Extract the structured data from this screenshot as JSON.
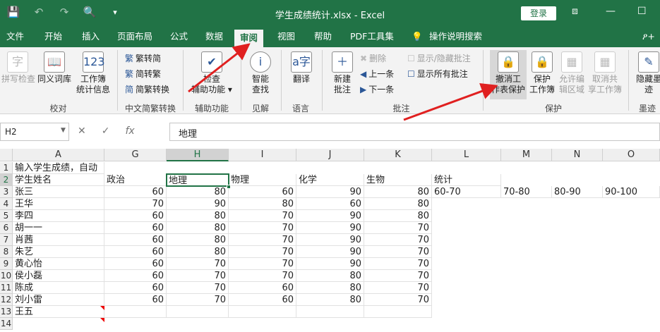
{
  "titlebar": {
    "title": "学生成绩统计.xlsx - Excel",
    "login": "登录",
    "qat": {
      "save_icon": "💾",
      "undo_icon": "↶",
      "redo_icon": "↷",
      "preview_icon": "🔍",
      "more_icon": "▾"
    },
    "win": {
      "restore": "⧈",
      "min": "—",
      "max": "☐"
    }
  },
  "menu": {
    "tabs": [
      "文件",
      "开始",
      "插入",
      "页面布局",
      "公式",
      "数据",
      "审阅",
      "视图",
      "帮助",
      "PDF工具集",
      "操作说明搜索"
    ],
    "share": "ዖ+"
  },
  "ribbon": {
    "spell": "拼写检查",
    "thesaurus": "同义词库",
    "stats_line1": "工作簿",
    "stats_line2": "统计信息",
    "to_trad": "繁转简",
    "to_simp": "简转繁",
    "conv": "简繁转换",
    "check_line1": "检查",
    "check_line2": "辅助功能",
    "smart_line1": "智能",
    "smart_line2": "查找",
    "translate": "翻译",
    "newc_line1": "新建",
    "newc_line2": "批注",
    "del": "删除",
    "prev": "上一条",
    "next": "下一条",
    "showhide": "显示/隐藏批注",
    "showall": "显示所有批注",
    "unprotect_line1": "撤消工",
    "unprotect_line2": "作表保护",
    "protectwb_line1": "保护",
    "protectwb_line2": "工作簿",
    "allow_line1": "允许编",
    "allow_line2": "辑区域",
    "unshare_line1": "取消共",
    "unshare_line2": "享工作簿",
    "ink_line1": "隐藏墨",
    "ink_line2": "迹",
    "groups": [
      "校对",
      "中文简繁转换",
      "辅助功能",
      "见解",
      "语言",
      "批注",
      "保护",
      "墨迹"
    ]
  },
  "formula": {
    "namebox": "H2",
    "value": "地理",
    "cancel": "✕",
    "enter": "✓",
    "fx": "fx"
  },
  "sheet": {
    "columns": [
      "A",
      "G",
      "H",
      "I",
      "J",
      "K",
      "L",
      "M",
      "N",
      "O"
    ],
    "rows": [
      "1",
      "2",
      "3",
      "4",
      "5",
      "6",
      "7",
      "8",
      "9",
      "10",
      "11",
      "12",
      "13",
      "14"
    ],
    "a1": "输入学生成绩，自动",
    "headers": [
      "学生姓名",
      "政治",
      "地理",
      "物理",
      "化学",
      "生物",
      "统计"
    ],
    "ranges": [
      "60-70",
      "70-80",
      "80-90",
      "90-100"
    ],
    "students": [
      {
        "name": "张三",
        "g": "60",
        "h": "80",
        "i": "60",
        "j": "90",
        "k": "80"
      },
      {
        "name": "王华",
        "g": "70",
        "h": "90",
        "i": "80",
        "j": "60",
        "k": "80"
      },
      {
        "name": "李四",
        "g": "60",
        "h": "80",
        "i": "70",
        "j": "90",
        "k": "80"
      },
      {
        "name": "胡一一",
        "g": "60",
        "h": "80",
        "i": "70",
        "j": "90",
        "k": "70"
      },
      {
        "name": "肖茜",
        "g": "60",
        "h": "80",
        "i": "70",
        "j": "90",
        "k": "70"
      },
      {
        "name": "朱艺",
        "g": "60",
        "h": "80",
        "i": "70",
        "j": "90",
        "k": "70"
      },
      {
        "name": "黄心怡",
        "g": "60",
        "h": "70",
        "i": "70",
        "j": "90",
        "k": "70"
      },
      {
        "name": "侯小磊",
        "g": "60",
        "h": "70",
        "i": "70",
        "j": "80",
        "k": "70"
      },
      {
        "name": "陈成",
        "g": "60",
        "h": "70",
        "i": "60",
        "j": "80",
        "k": "70"
      },
      {
        "name": "刘小雷",
        "g": "60",
        "h": "70",
        "i": "60",
        "j": "80",
        "k": "70"
      },
      {
        "name": "王五",
        "g": "",
        "h": "",
        "i": "",
        "j": "",
        "k": ""
      }
    ]
  },
  "colors": {
    "accent": "#217346",
    "arrow": "#e02020"
  }
}
